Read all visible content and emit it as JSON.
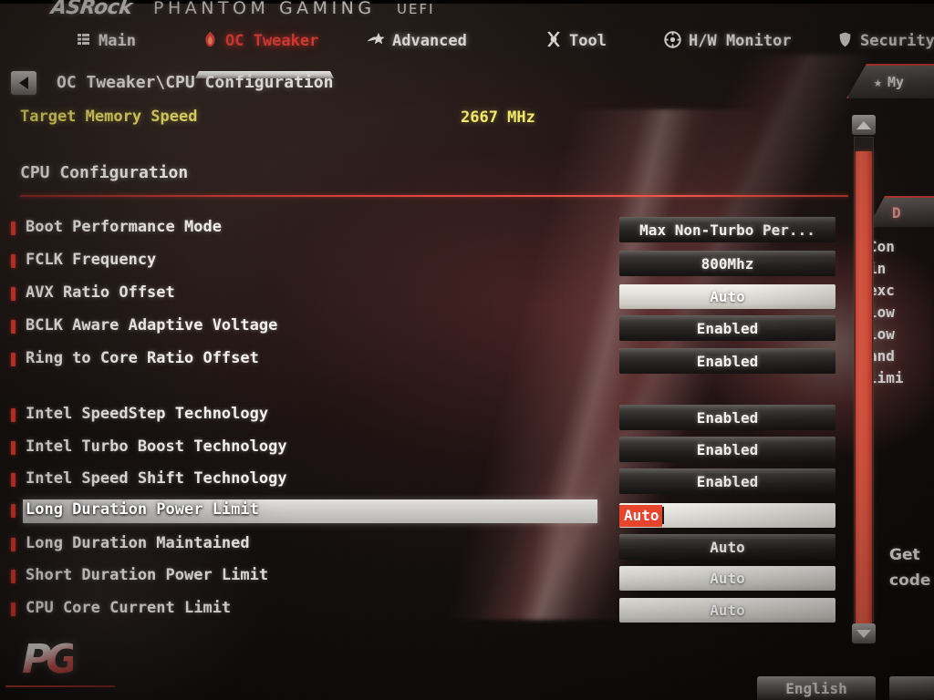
{
  "brand": {
    "vendor": "ASRock",
    "product": "PHANTOM GAMING",
    "firmware": "UEFI",
    "footer_logo": "PG"
  },
  "nav": {
    "items": [
      {
        "label": "Main",
        "icon": "grid-icon",
        "active": false
      },
      {
        "label": "OC Tweaker",
        "icon": "flame-icon",
        "active": true
      },
      {
        "label": "Advanced",
        "icon": "star-icon",
        "active": false
      },
      {
        "label": "Tool",
        "icon": "wrench-icon",
        "active": false
      },
      {
        "label": "H/W Monitor",
        "icon": "gauge-icon",
        "active": false
      },
      {
        "label": "Security",
        "icon": "shield-icon",
        "active": false
      }
    ]
  },
  "breadcrumb": {
    "back_icon": "back-arrow-icon",
    "path": "OC Tweaker\\CPU Configuration"
  },
  "info_row": {
    "label": "Target Memory Speed",
    "value": "2667 MHz"
  },
  "section": {
    "title": "CPU Configuration"
  },
  "settings": [
    {
      "label": "Boot Performance Mode",
      "value": "Max Non-Turbo Per...",
      "style": "dark",
      "selected": false
    },
    {
      "label": "FCLK Frequency",
      "value": "800Mhz",
      "style": "dark",
      "selected": false
    },
    {
      "label": "AVX Ratio Offset",
      "value": "Auto",
      "style": "light",
      "selected": false
    },
    {
      "label": "BCLK Aware Adaptive Voltage",
      "value": "Enabled",
      "style": "dark",
      "selected": false
    },
    {
      "label": "Ring to Core Ratio Offset",
      "value": "Enabled",
      "style": "dark",
      "selected": false
    },
    {
      "label": "Intel SpeedStep Technology",
      "value": "Enabled",
      "style": "dark",
      "selected": false
    },
    {
      "label": "Intel Turbo Boost Technology",
      "value": "Enabled",
      "style": "dark",
      "selected": false
    },
    {
      "label": "Intel Speed Shift Technology",
      "value": "Enabled",
      "style": "dark",
      "selected": false
    },
    {
      "label": "Long Duration Power Limit",
      "value": "Auto",
      "style": "editing",
      "selected": true
    },
    {
      "label": "Long Duration Maintained",
      "value": "Auto",
      "style": "dark",
      "selected": false
    },
    {
      "label": "Short Duration Power Limit",
      "value": "Auto",
      "style": "light",
      "selected": false
    },
    {
      "label": "CPU Core Current Limit",
      "value": "Auto",
      "style": "light",
      "selected": false
    }
  ],
  "favorite_tab": {
    "icon": "star-icon",
    "label": "My"
  },
  "description": {
    "heading": "D",
    "body": "Con\nin\nexc\nlow\nlow\nand\nlimi"
  },
  "hint": {
    "text": "Get\ncode"
  },
  "scrollbar": {
    "up_icon": "scroll-up-icon",
    "down_icon": "scroll-down-icon"
  },
  "bottom_bar": {
    "language": "English",
    "extra": ""
  },
  "colors": {
    "accent_red": "#e0453a",
    "selection_red": "#e8452c",
    "info_yellow": "#f2e96a",
    "text_white": "#f3f0ee",
    "panel_dark": "#242120"
  }
}
